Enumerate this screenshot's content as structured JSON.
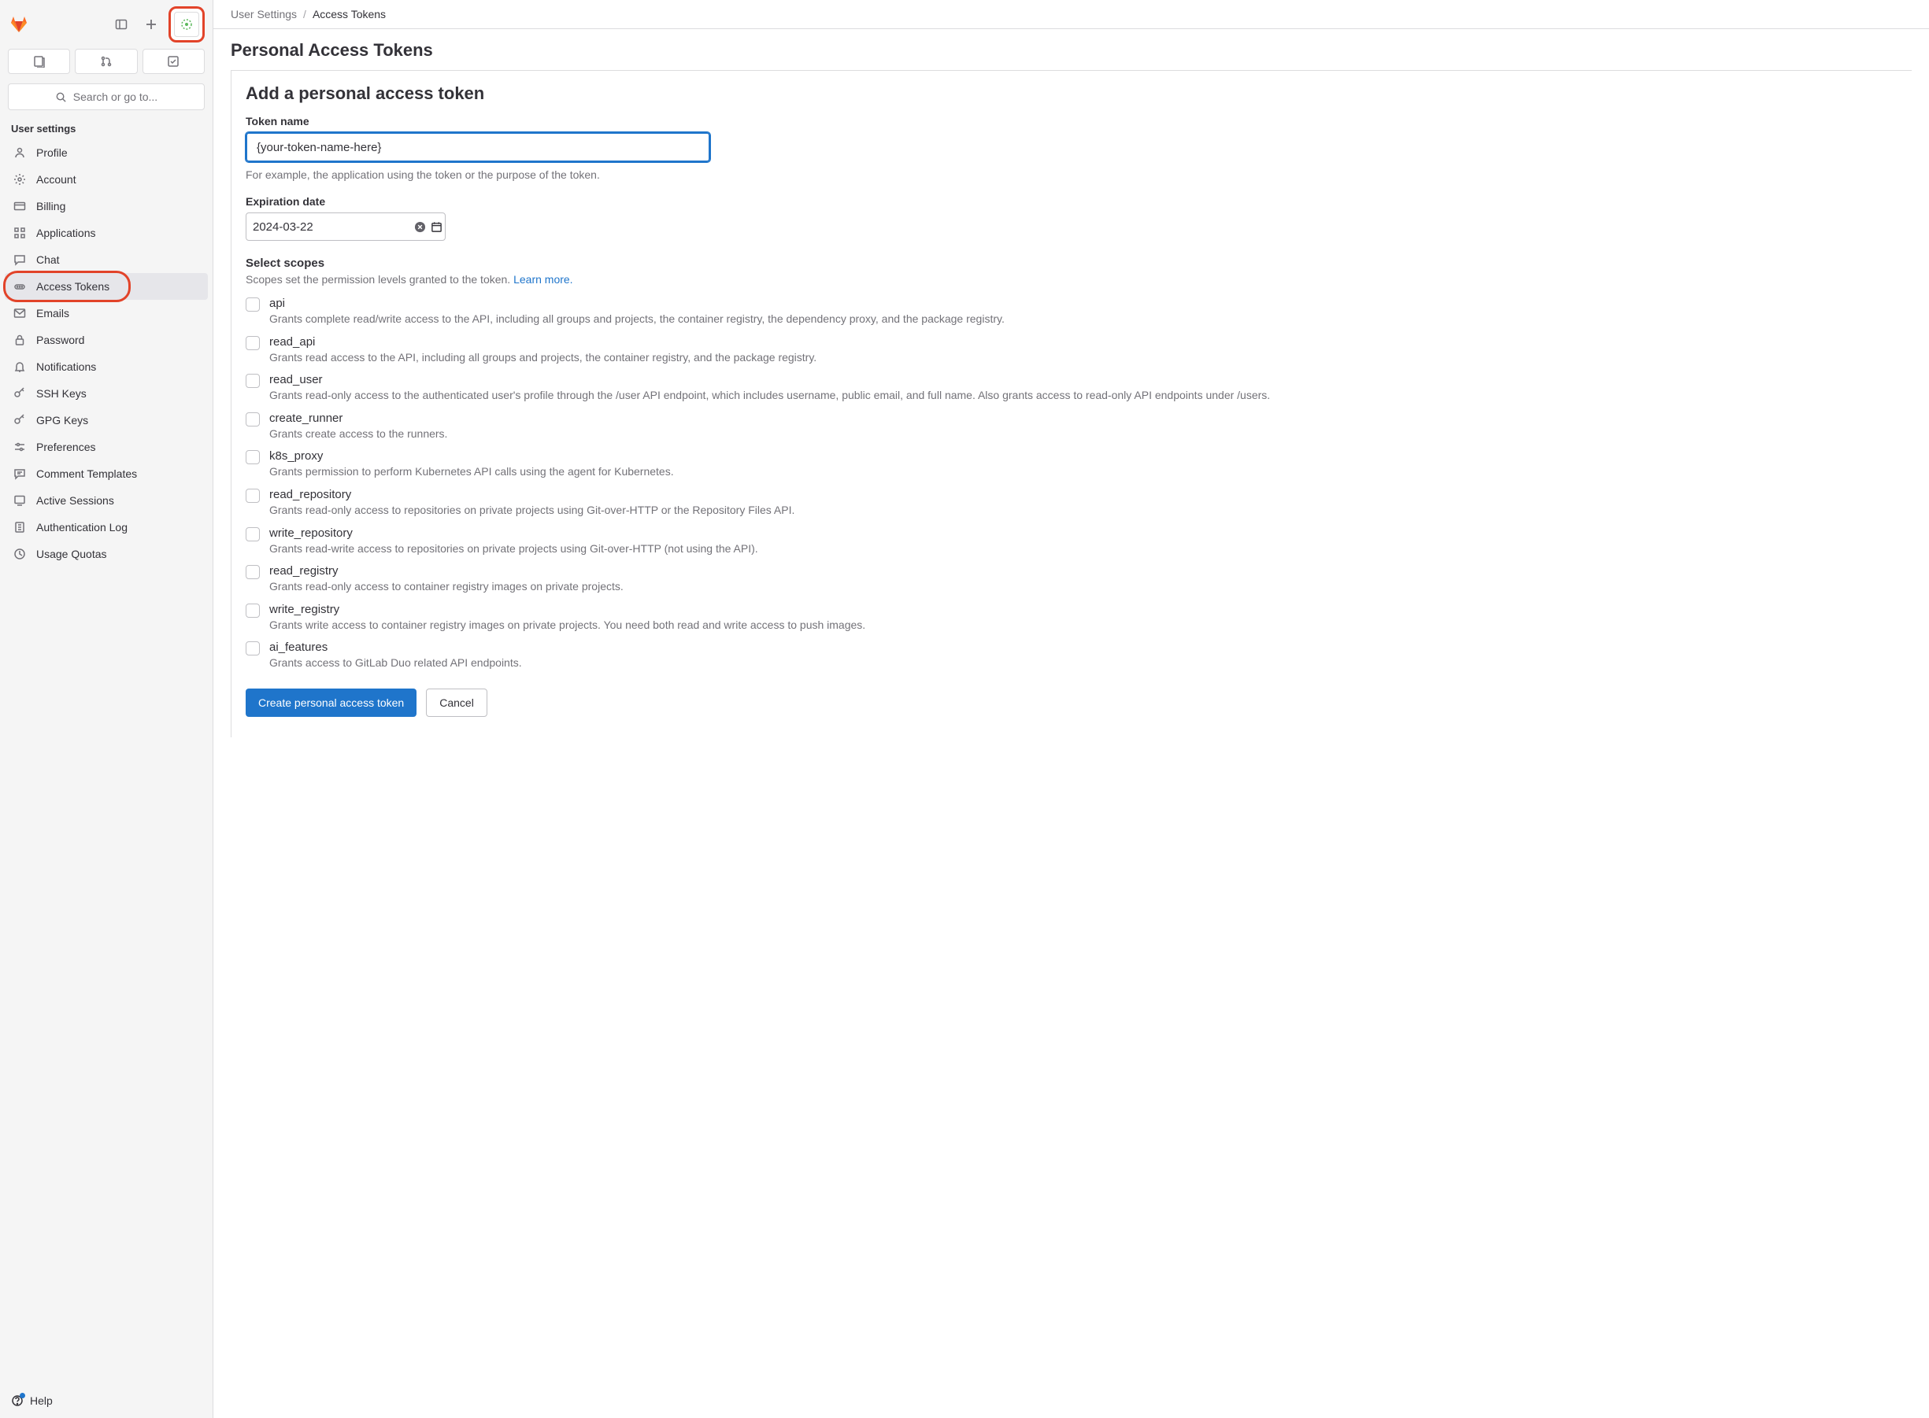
{
  "breadcrumb": {
    "parent": "User Settings",
    "current": "Access Tokens"
  },
  "page_title": "Personal Access Tokens",
  "panel_title": "Add a personal access token",
  "token_name": {
    "label": "Token name",
    "value": "{your-token-name-here}",
    "help": "For example, the application using the token or the purpose of the token."
  },
  "expiration": {
    "label": "Expiration date",
    "value": "2024-03-22"
  },
  "scopes": {
    "title": "Select scopes",
    "help_text": "Scopes set the permission levels granted to the token. ",
    "learn_more": "Learn more.",
    "items": [
      {
        "name": "api",
        "desc": "Grants complete read/write access to the API, including all groups and projects, the container registry, the dependency proxy, and the package registry."
      },
      {
        "name": "read_api",
        "desc": "Grants read access to the API, including all groups and projects, the container registry, and the package registry."
      },
      {
        "name": "read_user",
        "desc": "Grants read-only access to the authenticated user's profile through the /user API endpoint, which includes username, public email, and full name. Also grants access to read-only API endpoints under /users."
      },
      {
        "name": "create_runner",
        "desc": "Grants create access to the runners."
      },
      {
        "name": "k8s_proxy",
        "desc": "Grants permission to perform Kubernetes API calls using the agent for Kubernetes."
      },
      {
        "name": "read_repository",
        "desc": "Grants read-only access to repositories on private projects using Git-over-HTTP or the Repository Files API."
      },
      {
        "name": "write_repository",
        "desc": "Grants read-write access to repositories on private projects using Git-over-HTTP (not using the API)."
      },
      {
        "name": "read_registry",
        "desc": "Grants read-only access to container registry images on private projects."
      },
      {
        "name": "write_registry",
        "desc": "Grants write access to container registry images on private projects. You need both read and write access to push images."
      },
      {
        "name": "ai_features",
        "desc": "Grants access to GitLab Duo related API endpoints."
      }
    ]
  },
  "actions": {
    "primary": "Create personal access token",
    "secondary": "Cancel"
  },
  "sidebar": {
    "search_placeholder": "Search or go to...",
    "section_label": "User settings",
    "help": "Help",
    "items": [
      {
        "label": "Profile"
      },
      {
        "label": "Account"
      },
      {
        "label": "Billing"
      },
      {
        "label": "Applications"
      },
      {
        "label": "Chat"
      },
      {
        "label": "Access Tokens"
      },
      {
        "label": "Emails"
      },
      {
        "label": "Password"
      },
      {
        "label": "Notifications"
      },
      {
        "label": "SSH Keys"
      },
      {
        "label": "GPG Keys"
      },
      {
        "label": "Preferences"
      },
      {
        "label": "Comment Templates"
      },
      {
        "label": "Active Sessions"
      },
      {
        "label": "Authentication Log"
      },
      {
        "label": "Usage Quotas"
      }
    ]
  }
}
